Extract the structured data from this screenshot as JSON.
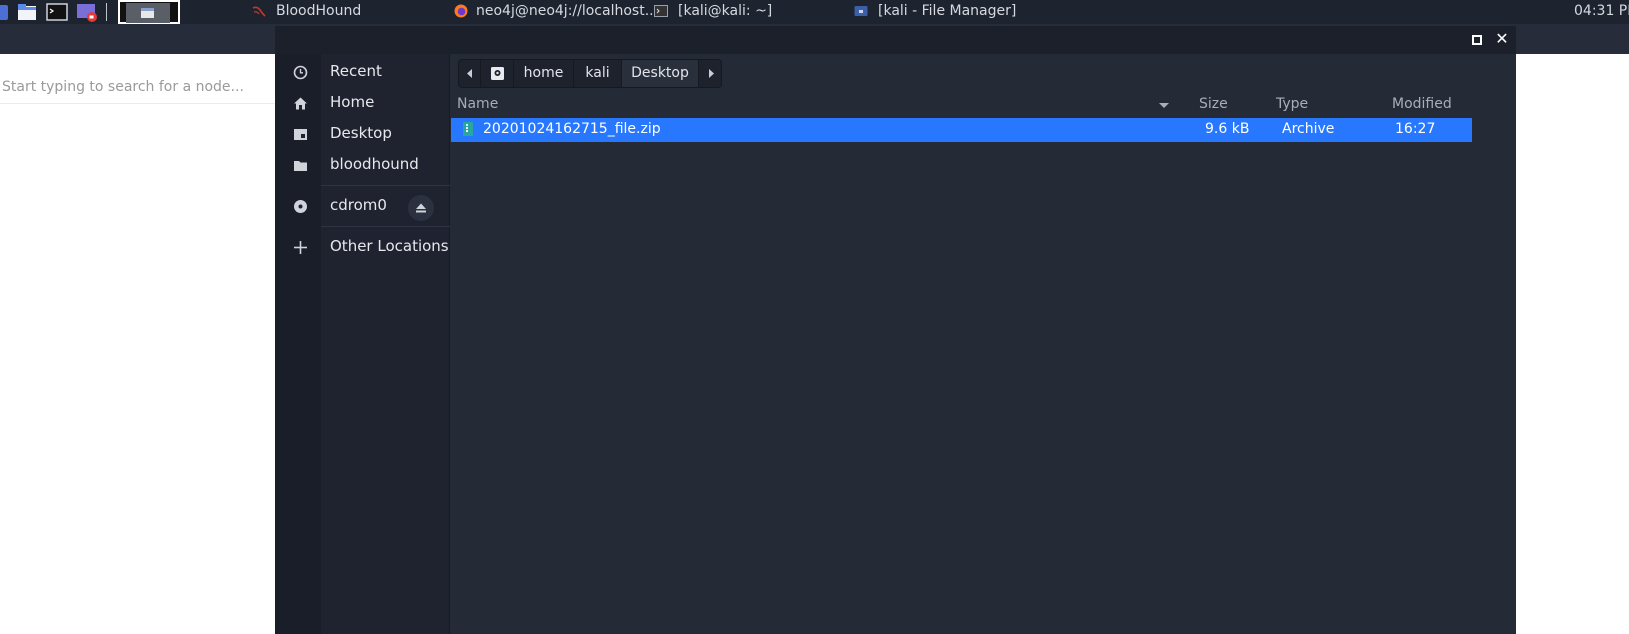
{
  "taskbar": {
    "launchers": [
      "app-menu-icon",
      "file-manager-icon",
      "terminal-icon",
      "screen-recorder-icon"
    ],
    "tasks": [
      {
        "label": "BloodHound",
        "icon": "bloodhound-icon"
      },
      {
        "label": "neo4j@neo4j://localhost...",
        "icon": "firefox-icon"
      },
      {
        "label": "[kali@kali: ~]",
        "icon": "terminal-icon"
      },
      {
        "label": "[kali - File Manager]",
        "icon": "file-manager-icon"
      }
    ],
    "clock": "04:31 PM"
  },
  "background_app": {
    "search_placeholder": "Start typing to search for a node..."
  },
  "dialog": {
    "places": [
      {
        "label": "Recent",
        "icon": "clock-icon"
      },
      {
        "label": "Home",
        "icon": "home-icon"
      },
      {
        "label": "Desktop",
        "icon": "desktop-icon"
      },
      {
        "label": "bloodhound",
        "icon": "folder-icon"
      }
    ],
    "devices": [
      {
        "label": "cdrom0",
        "icon": "disc-icon",
        "action_icon": "eject-icon"
      }
    ],
    "other": {
      "label": "Other Locations",
      "icon": "plus-icon"
    },
    "path": {
      "segments": [
        "home",
        "kali",
        "Desktop"
      ],
      "active": "Desktop"
    },
    "columns": {
      "name": "Name",
      "size": "Size",
      "type": "Type",
      "modified": "Modified"
    },
    "files": [
      {
        "name": "20201024162715_file.zip",
        "size": "9.6 kB",
        "type": "Archive",
        "modified": "16:27",
        "selected": true
      }
    ]
  },
  "colors": {
    "selection": "#2777ff",
    "dialog_bg": "#252a37",
    "sidebar_bg": "#1f2330",
    "taskbar_bg": "#1e2330"
  }
}
